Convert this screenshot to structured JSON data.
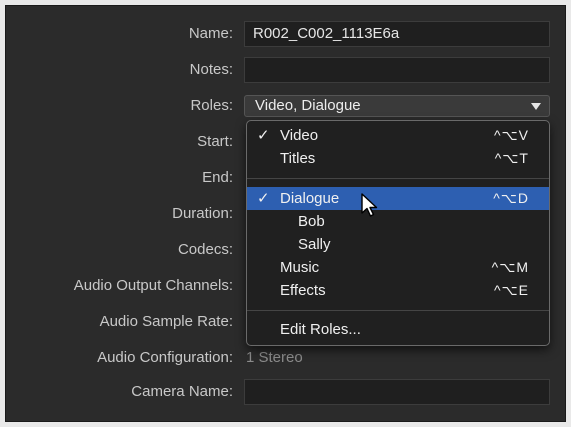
{
  "fields": {
    "name": {
      "label": "Name:",
      "value": "R002_C002_1113E6a"
    },
    "notes": {
      "label": "Notes:",
      "value": ""
    },
    "roles": {
      "label": "Roles:",
      "value": "Video, Dialogue"
    },
    "start": {
      "label": "Start:"
    },
    "end": {
      "label": "End:"
    },
    "duration": {
      "label": "Duration:"
    },
    "codecs": {
      "label": "Codecs:"
    },
    "audio_output_channels": {
      "label": "Audio Output Channels:"
    },
    "audio_sample_rate": {
      "label": "Audio Sample Rate:"
    },
    "audio_configuration": {
      "label": "Audio Configuration:",
      "value": "1 Stereo"
    },
    "camera_name": {
      "label": "Camera Name:",
      "value": ""
    }
  },
  "roles_menu": {
    "items": [
      {
        "label": "Video",
        "checked": "✓",
        "shortcut": "^⌥V"
      },
      {
        "label": "Titles",
        "checked": "",
        "shortcut": "^⌥T"
      },
      {
        "label": "Dialogue",
        "checked": "✓",
        "shortcut": "^⌥D",
        "highlighted": true
      },
      {
        "label": "Bob",
        "checked": "",
        "shortcut": ""
      },
      {
        "label": "Sally",
        "checked": "",
        "shortcut": ""
      },
      {
        "label": "Music",
        "checked": "",
        "shortcut": "^⌥M"
      },
      {
        "label": "Effects",
        "checked": "",
        "shortcut": "^⌥E"
      },
      {
        "label": "Edit Roles...",
        "checked": "",
        "shortcut": ""
      }
    ]
  },
  "colors": {
    "highlight": "#2d5fb1",
    "background": "#2b2b2b"
  }
}
